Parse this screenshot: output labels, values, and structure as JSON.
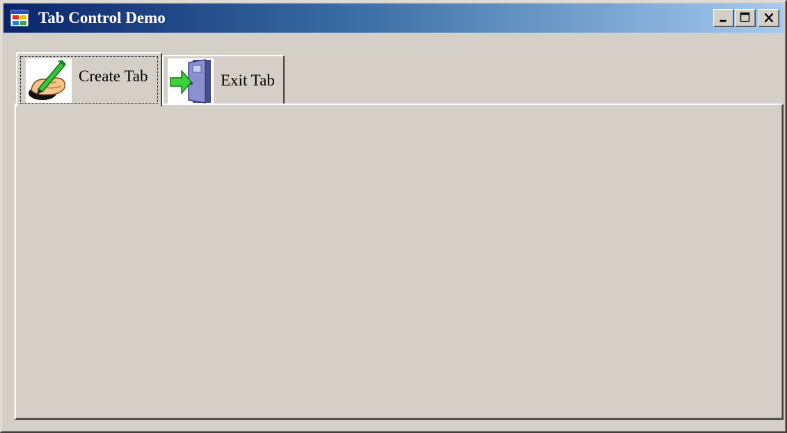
{
  "window": {
    "title": "Tab Control Demo",
    "caption_buttons": {
      "minimize_icon": "minimize-icon",
      "maximize_icon": "maximize-icon",
      "close_icon": "close-icon"
    },
    "colors": {
      "titlebar_start": "#0a246a",
      "titlebar_end": "#a6caf0",
      "face": "#d4d0c8"
    }
  },
  "tabs": [
    {
      "label": "Create Tab",
      "icon": "hand-writing-pen-icon",
      "selected": true
    },
    {
      "label": "Exit Tab",
      "icon": "exit-door-icon",
      "selected": false
    }
  ]
}
